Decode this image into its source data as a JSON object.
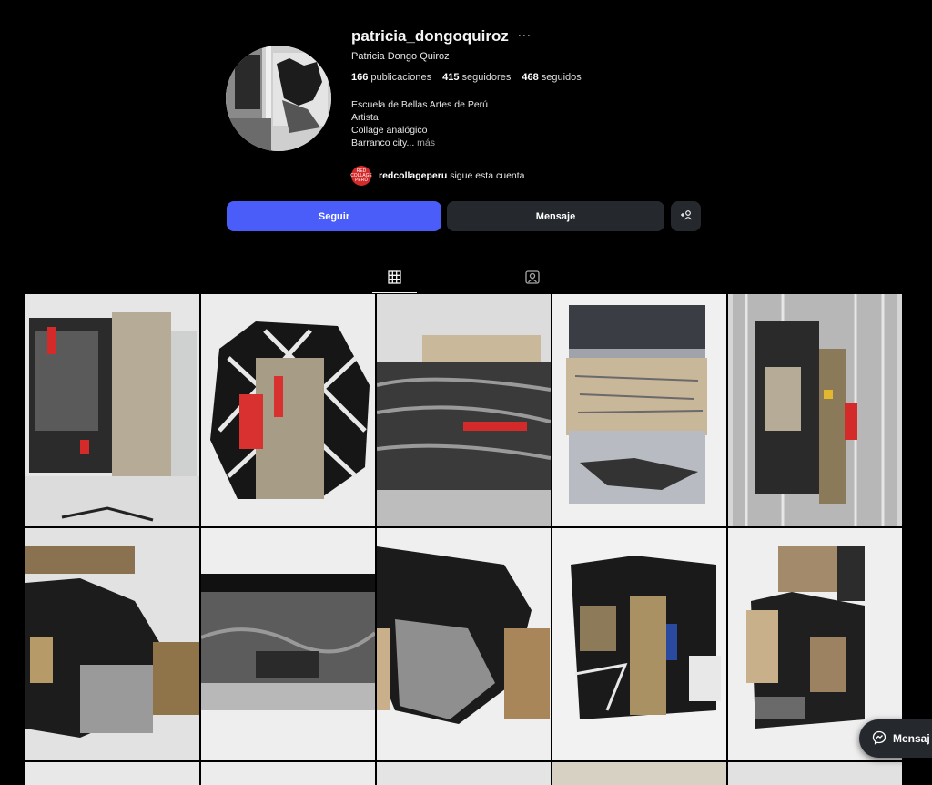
{
  "profile": {
    "username": "patricia_dongoquiroz",
    "more_icon": "···",
    "full_name": "Patricia Dongo Quiroz",
    "stats": {
      "posts_count": "166",
      "posts_label": "publicaciones",
      "followers_count": "415",
      "followers_label": "seguidores",
      "following_count": "468",
      "following_label": "seguidos"
    },
    "bio": [
      "Escuela de Bellas Artes de Perú",
      "Artista",
      "Collage analógico",
      "Barranco city..."
    ],
    "bio_more": "más",
    "followed_by": {
      "avatar_text": "RED COLLAGE PERÚ",
      "account": "redcollageperu",
      "text": "sigue esta cuenta"
    }
  },
  "actions": {
    "follow_label": "Seguir",
    "message_label": "Mensaje",
    "adduser_icon": "+♁"
  },
  "tabs": [
    {
      "name": "posts",
      "icon": "grid-icon",
      "active": true
    },
    {
      "name": "tagged",
      "icon": "tagged-icon",
      "active": false
    }
  ],
  "chat": {
    "label": "Mensaj",
    "icon": "messenger-icon"
  },
  "colors": {
    "background": "#000000",
    "follow_button": "#4a5df9",
    "secondary_button": "#25292e",
    "accent_red": "#d42a2a"
  }
}
